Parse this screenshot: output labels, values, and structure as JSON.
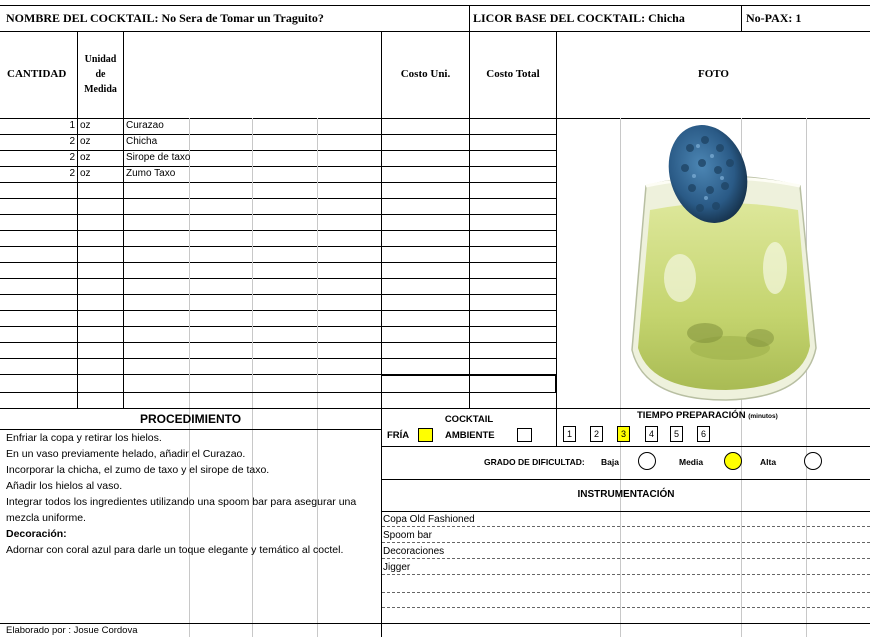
{
  "header": {
    "cocktail_name": "NOMBRE DEL COCKTAIL: No Sera de Tomar un Traguito?",
    "base_liquor": "LICOR BASE DEL COCKTAIL: Chicha",
    "pax": "No-PAX: 1"
  },
  "columns": {
    "cantidad": "CANTIDAD",
    "unidad_l1": "Unidad",
    "unidad_l2": "de",
    "unidad_l3": "Medida",
    "costo_uni": "Costo Uni.",
    "costo_total": "Costo Total",
    "foto": "FOTO"
  },
  "ingredients": [
    {
      "qty": "1",
      "unit": "oz",
      "name": "Curazao"
    },
    {
      "qty": "2",
      "unit": "oz",
      "name": "Chicha"
    },
    {
      "qty": "2",
      "unit": "oz",
      "name": "Sirope de taxo"
    },
    {
      "qty": "2",
      "unit": "oz",
      "name": "Zumo Taxo"
    }
  ],
  "procedure": {
    "title": "PROCEDIMIENTO",
    "steps": [
      "Enfriar la copa y retirar los hielos.",
      "En un vaso previamente helado, añadir el Curazao.",
      "Incorporar la chicha, el zumo de taxo y el sirope de taxo.",
      "Añadir los hielos al vaso.",
      "Integrar todos los ingredientes utilizando una spoom bar para asegurar una",
      "mezcla uniforme."
    ],
    "decoration_label": "Decoración:",
    "decoration_text": "Adornar con coral azul para darle un toque elegante y temático al coctel.",
    "author": "Elaborado por : Josue Cordova"
  },
  "cocktail_type": {
    "title": "COCKTAIL",
    "fria": "FRÍA",
    "ambiente": "AMBIENTE",
    "selected": "FRÍA"
  },
  "prep_time": {
    "title": "TIEMPO PREPARACIÓN",
    "unit": "(minutos)",
    "options": [
      "1",
      "2",
      "3",
      "4",
      "5",
      "6"
    ],
    "selected": "3"
  },
  "difficulty": {
    "label": "GRADO DE DIFICULTAD:",
    "options": [
      "Baja",
      "Media",
      "Alta"
    ],
    "selected": "Media"
  },
  "instrumentation": {
    "title": "INSTRUMENTACIÓN",
    "items": [
      "Copa Old Fashioned",
      "Spoom bar",
      "Decoraciones",
      "Jigger"
    ]
  },
  "colors": {
    "highlight": "#ffff00",
    "drink": "#c9d97a",
    "coral": "#2f5f8a"
  },
  "photo": {
    "icon": "cocktail-photo"
  }
}
